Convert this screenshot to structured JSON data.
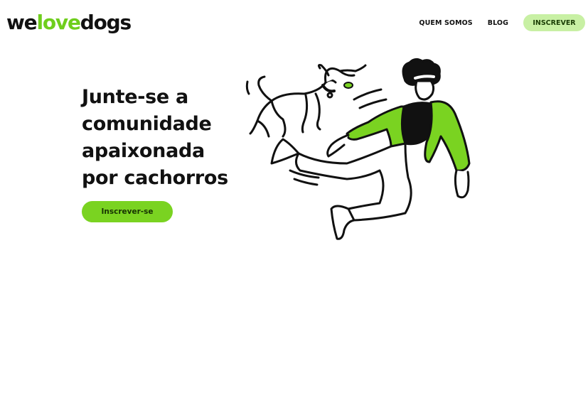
{
  "brand": {
    "part1": "we",
    "part2": "love",
    "part3": "dogs"
  },
  "nav": {
    "items": [
      {
        "label": "QUEM SOMOS"
      },
      {
        "label": "BLOG"
      }
    ],
    "cta_label": "INSCREVER"
  },
  "hero": {
    "title": "Junte-se a comunidade apaixonada por cachorros",
    "cta_label": "Inscrever-se",
    "illustration": "person-running-with-dog"
  },
  "colors": {
    "accent": "#7ad321",
    "accent_light": "#c8f0a4",
    "text": "#111111",
    "background": "#ffffff"
  }
}
